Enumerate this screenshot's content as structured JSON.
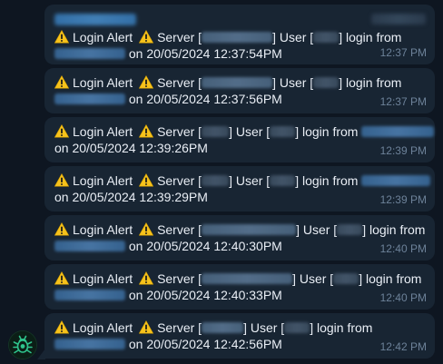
{
  "chat": {
    "messages": [
      {
        "alert": "Login Alert",
        "server_label": "Server [",
        "user_label": "] User [",
        "login_label": "] login from",
        "on_label": "on",
        "datetime": "20/05/2024 12:37:54PM",
        "time": "12:37 PM"
      },
      {
        "alert": "Login Alert",
        "server_label": "Server [",
        "user_label": "] User [",
        "login_label": "] login from",
        "on_label": "on",
        "datetime": "20/05/2024 12:37:56PM",
        "time": "12:37 PM"
      },
      {
        "alert": "Login Alert",
        "server_label": "Server [",
        "user_label": "] User [",
        "login_label": "] login from",
        "on_label": "on",
        "datetime": "20/05/2024 12:39:26PM",
        "time": "12:39 PM"
      },
      {
        "alert": "Login Alert",
        "server_label": "Server [",
        "user_label": "] User [",
        "login_label": "] login from",
        "on_label": "on",
        "datetime": "20/05/2024 12:39:29PM",
        "time": "12:39 PM"
      },
      {
        "alert": "Login Alert",
        "server_label": "Server [",
        "user_label": "] User [",
        "login_label": "] login from",
        "on_label": "on",
        "datetime": "20/05/2024 12:40:30PM",
        "time": "12:40 PM"
      },
      {
        "alert": "Login Alert",
        "server_label": "Server [",
        "user_label": "] User [",
        "login_label": "] login from",
        "on_label": "on",
        "datetime": "20/05/2024 12:40:33PM",
        "time": "12:40 PM"
      },
      {
        "alert": "Login Alert",
        "server_label": "Server [",
        "user_label": "] User [",
        "login_label": "] login from",
        "on_label": "on",
        "datetime": "20/05/2024 12:42:56PM",
        "time": "12:42 PM"
      }
    ]
  },
  "colors": {
    "background": "#0e1621",
    "bubble": "#182533",
    "text": "#e9eef5",
    "time": "#6d8299",
    "warning": "#f6c21c"
  },
  "icons": {
    "warning": "warning-icon",
    "avatar": "bot-avatar-icon"
  }
}
